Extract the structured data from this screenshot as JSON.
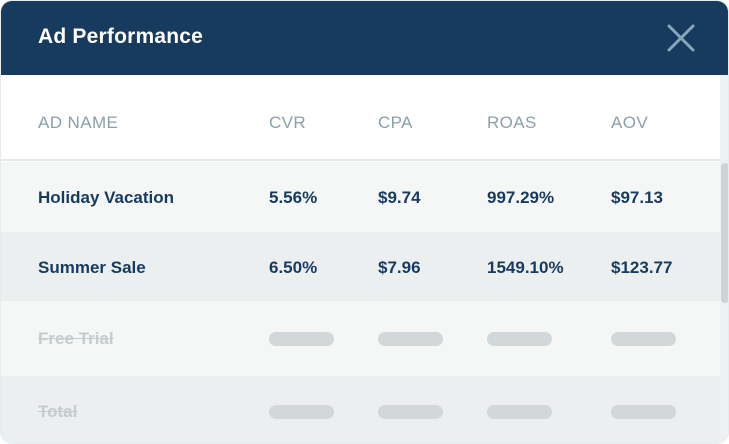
{
  "header": {
    "title": "Ad Performance",
    "close_icon": "close-icon",
    "background": "#173b5e"
  },
  "table": {
    "columns": [
      "AD NAME",
      "CVR",
      "CPA",
      "ROAS",
      "AOV"
    ],
    "rows": [
      {
        "name": "Holiday Vacation",
        "cvr": "5.56%",
        "cpa": "$9.74",
        "roas": "997.29%",
        "aov": "$97.13"
      },
      {
        "name": "Summer Sale",
        "cvr": "6.50%",
        "cpa": "$7.96",
        "roas": "1549.10%",
        "aov": "$123.77"
      }
    ],
    "placeholder_rows": [
      {
        "name": "Free Trial"
      },
      {
        "name": "Total"
      }
    ]
  }
}
